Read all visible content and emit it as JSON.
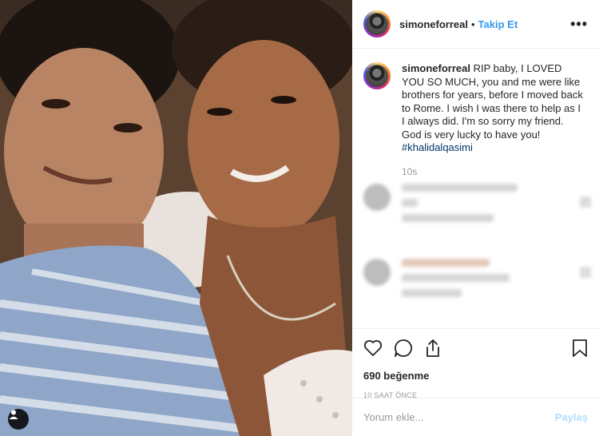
{
  "post": {
    "username": "simoneforreal",
    "separator": "•",
    "follow_label": "Takip Et",
    "more_label": "•••"
  },
  "caption": {
    "username": "simoneforreal",
    "text": "RIP baby, I LOVED YOU SO MUCH, you and me were like brothers for years, before I moved back to Rome. I wish I was there to help as I I always did. I'm so sorry my friend. God is very lucky to have you!",
    "hashtag": "#khalidalqasimi",
    "time": "10s"
  },
  "actions": {
    "icons": [
      "heart-icon",
      "comment-icon",
      "share-icon",
      "bookmark-icon"
    ],
    "likes": "690 beğenme",
    "time_ago": "10 SAAT ÖNCE"
  },
  "comment": {
    "placeholder": "Yorum ekle...",
    "post_label": "Paylaş"
  },
  "colors": {
    "follow": "#3897f0",
    "hashtag": "#003569",
    "post_disabled": "#b2dffc"
  }
}
